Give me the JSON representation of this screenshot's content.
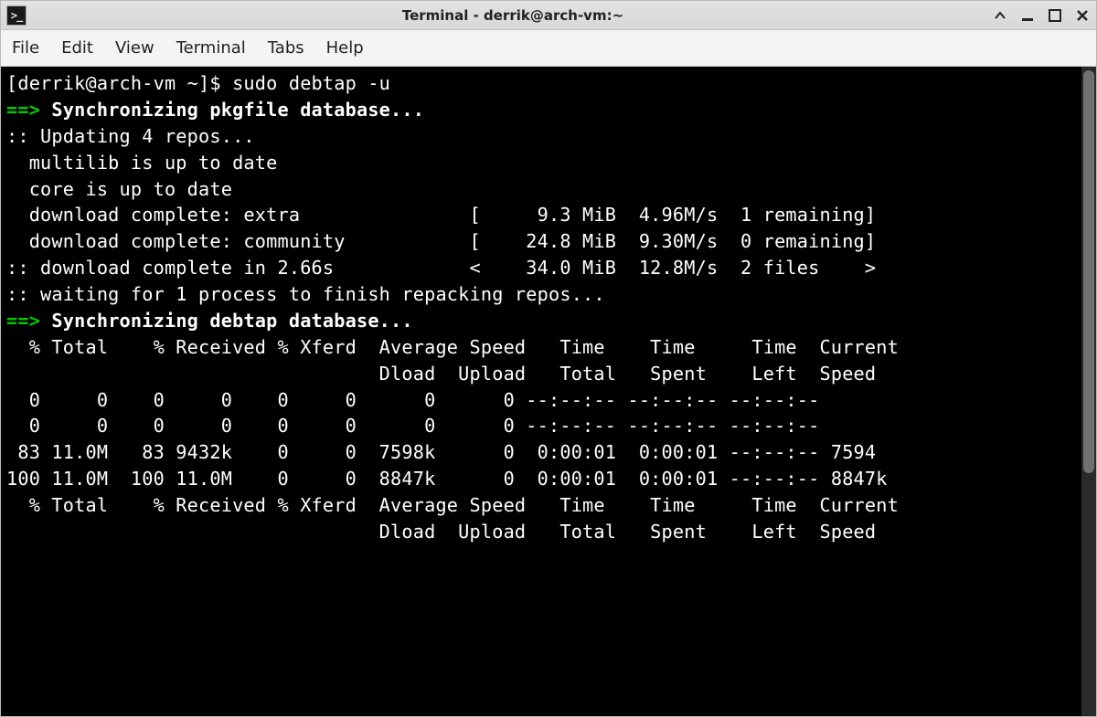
{
  "window": {
    "title": "Terminal - derrik@arch-vm:~"
  },
  "menubar": {
    "items": [
      "File",
      "Edit",
      "View",
      "Terminal",
      "Tabs",
      "Help"
    ]
  },
  "terminal": {
    "prompt": "[derrik@arch-vm ~]$ ",
    "command": "sudo debtap -u",
    "sync_pkgfile_arrow": "==> ",
    "sync_pkgfile": "Synchronizing pkgfile database...",
    "updating_repos": ":: Updating 4 repos...",
    "multilib": "  multilib is up to date",
    "core": "  core is up to date",
    "dl_extra": "  download complete: extra               [     9.3 MiB  4.96M/s  1 remaining]",
    "dl_community": "  download complete: community           [    24.8 MiB  9.30M/s  0 remaining]",
    "dl_total": ":: download complete in 2.66s            <    34.0 MiB  12.8M/s  2 files    >",
    "waiting": ":: waiting for 1 process to finish repacking repos...",
    "sync_debtap_arrow": "==> ",
    "sync_debtap": "Synchronizing debtap database...",
    "curl_hdr1": "  % Total    % Received % Xferd  Average Speed   Time    Time     Time  Current",
    "curl_hdr2": "                                 Dload  Upload   Total   Spent    Left  Speed",
    "curl_r1": "  0     0    0     0    0     0      0      0 --:--:-- --:--:-- --:--:--",
    "curl_r2": "  0     0    0     0    0     0      0      0 --:--:-- --:--:-- --:--:--",
    "curl_r3": " 83 11.0M   83 9432k    0     0  7598k      0  0:00:01  0:00:01 --:--:-- 7594",
    "curl_r4": "100 11.0M  100 11.0M    0     0  8847k      0  0:00:01  0:00:01 --:--:-- 8847k",
    "curl_hdr3": "  % Total    % Received % Xferd  Average Speed   Time    Time     Time  Current",
    "curl_hdr4": "                                 Dload  Upload   Total   Spent    Left  Speed"
  }
}
